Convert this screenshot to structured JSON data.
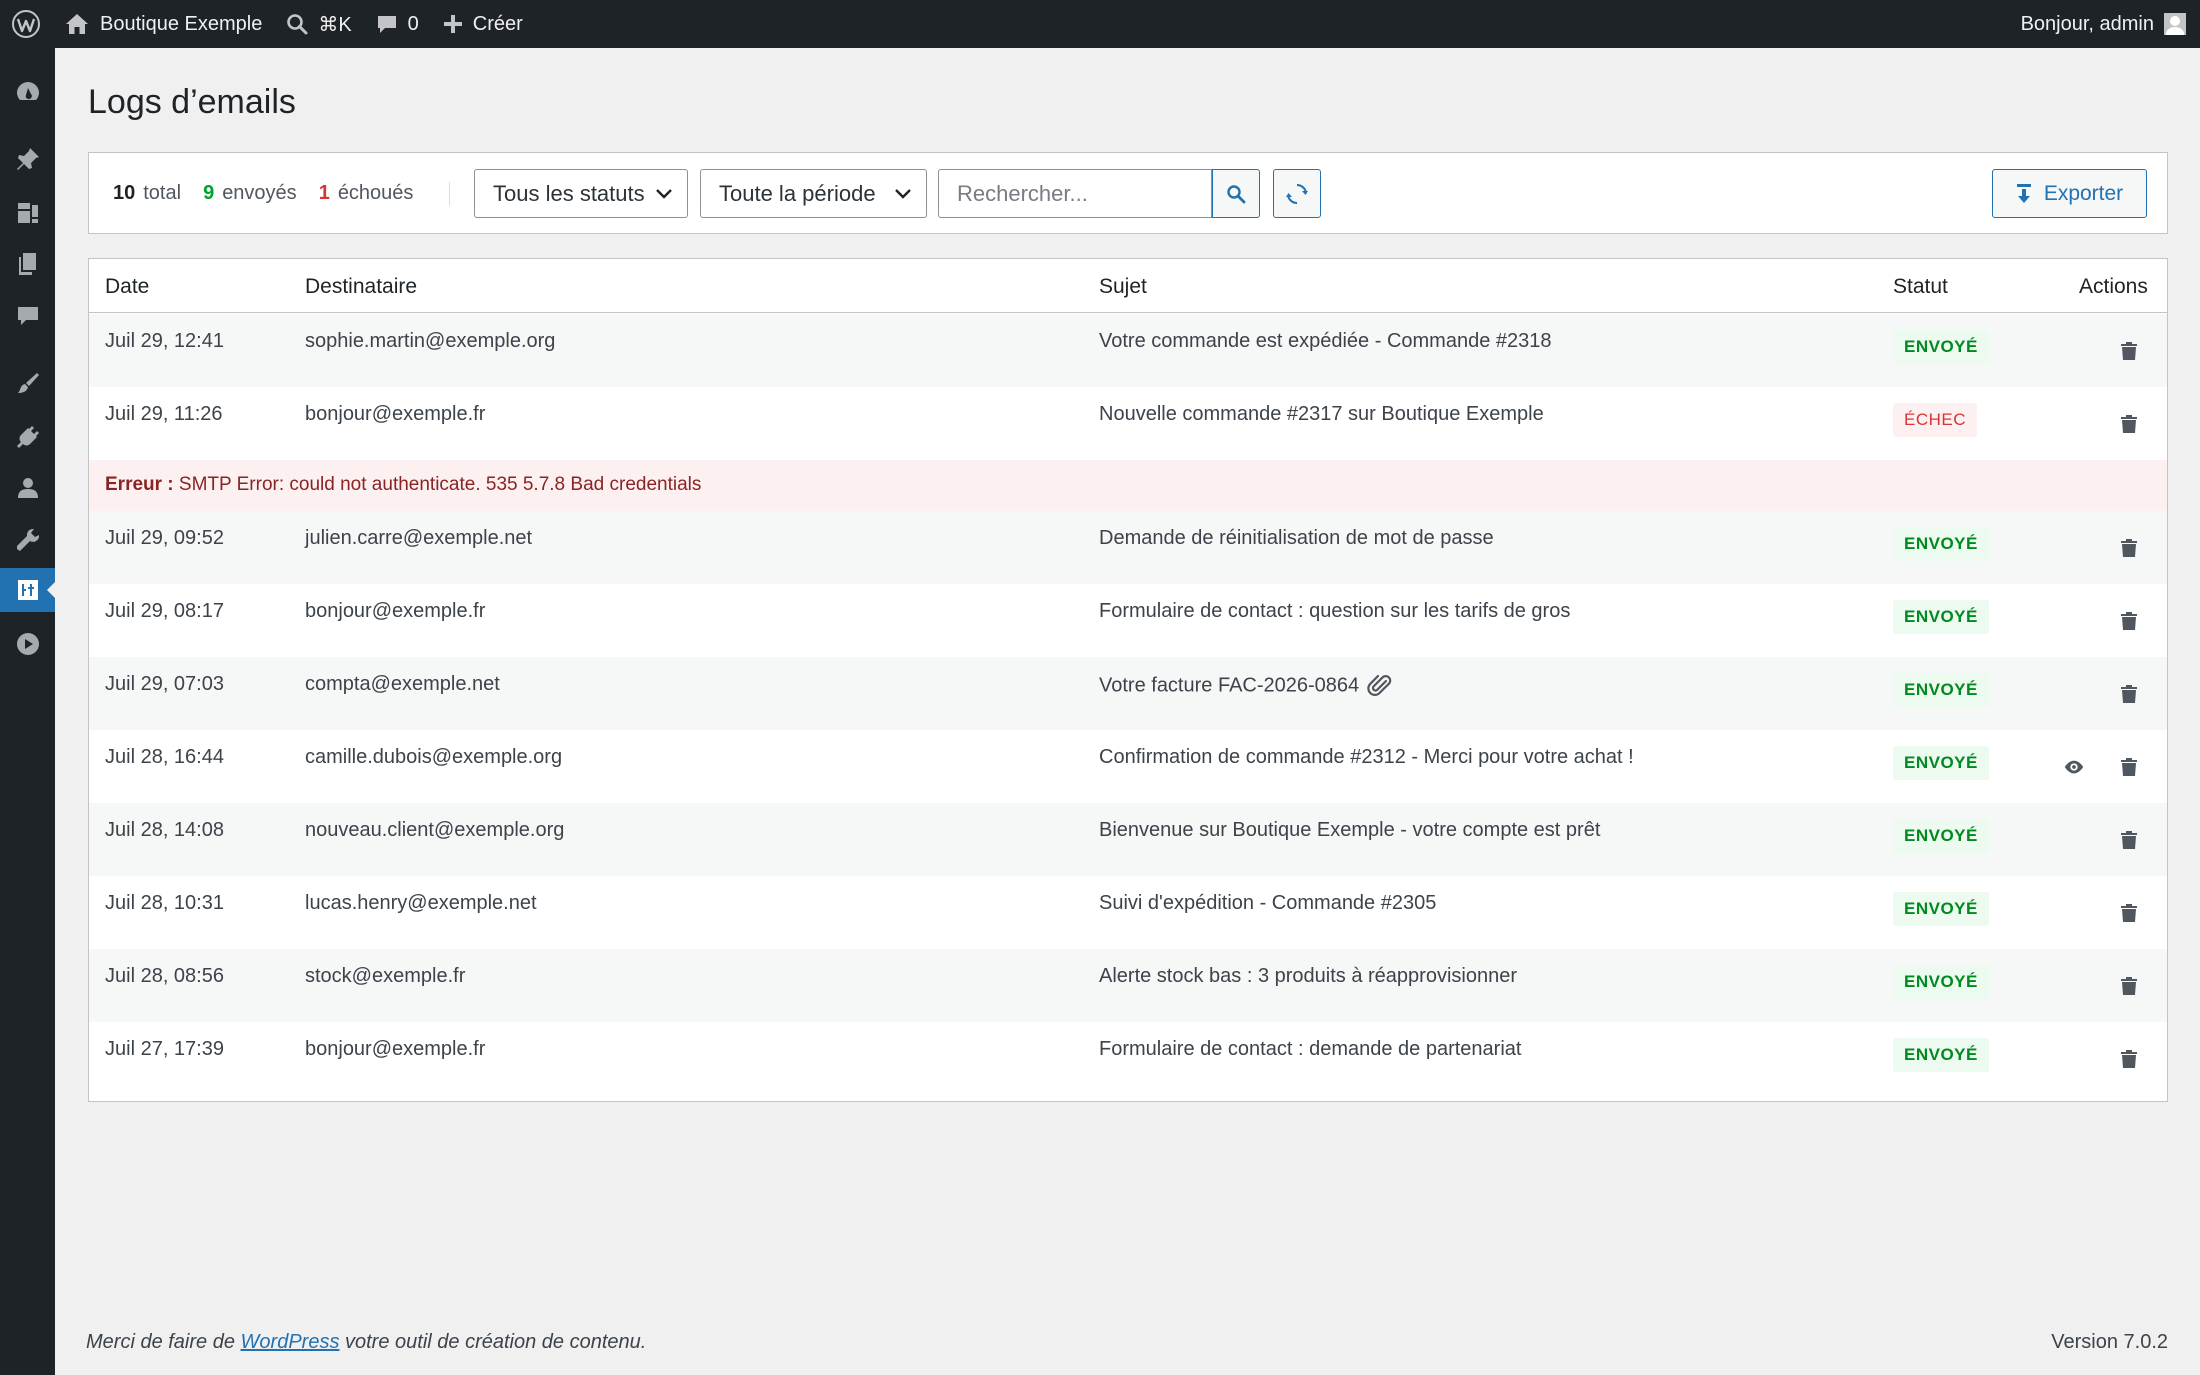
{
  "adminbar": {
    "site_name": "Boutique Exemple",
    "shortcut": "⌘K",
    "comments_count": "0",
    "create_label": "Créer",
    "greeting": "Bonjour, admin"
  },
  "page": {
    "title": "Logs d’emails"
  },
  "stats": {
    "total_num": "10",
    "total_label": "total",
    "sent_num": "9",
    "sent_label": "envoyés",
    "failed_num": "1",
    "failed_label": "échoués"
  },
  "filters": {
    "status_selected": "Tous les statuts",
    "period_selected": "Toute la période",
    "search_placeholder": "Rechercher...",
    "export_label": "Exporter"
  },
  "table": {
    "headers": {
      "date": "Date",
      "recipient": "Destinataire",
      "subject": "Sujet",
      "status": "Statut",
      "actions": "Actions"
    },
    "rows": [
      {
        "date": "Juil 29, 12:41",
        "recipient": "sophie.martin@exemple.org",
        "subject": "Votre commande est expédiée - Commande #2318",
        "status": "ENVOYÉ"
      },
      {
        "date": "Juil 29, 11:26",
        "recipient": "bonjour@exemple.fr",
        "subject": "Nouvelle commande #2317 sur Boutique Exemple",
        "status": "ÉCHEC"
      },
      {
        "date": "Juil 29, 09:52",
        "recipient": "julien.carre@exemple.net",
        "subject": "Demande de réinitialisation de mot de passe",
        "status": "ENVOYÉ"
      },
      {
        "date": "Juil 29, 08:17",
        "recipient": "bonjour@exemple.fr",
        "subject": "Formulaire de contact : question sur les tarifs de gros",
        "status": "ENVOYÉ"
      },
      {
        "date": "Juil 29, 07:03",
        "recipient": "compta@exemple.net",
        "subject": "Votre facture FAC-2026-0864",
        "status": "ENVOYÉ"
      },
      {
        "date": "Juil 28, 16:44",
        "recipient": "camille.dubois@exemple.org",
        "subject": "Confirmation de commande #2312 - Merci pour votre achat !",
        "status": "ENVOYÉ"
      },
      {
        "date": "Juil 28, 14:08",
        "recipient": "nouveau.client@exemple.org",
        "subject": "Bienvenue sur Boutique Exemple - votre compte est prêt",
        "status": "ENVOYÉ"
      },
      {
        "date": "Juil 28, 10:31",
        "recipient": "lucas.henry@exemple.net",
        "subject": "Suivi d'expédition - Commande #2305",
        "status": "ENVOYÉ"
      },
      {
        "date": "Juil 28, 08:56",
        "recipient": "stock@exemple.fr",
        "subject": "Alerte stock bas : 3 produits à réapprovisionner",
        "status": "ENVOYÉ"
      },
      {
        "date": "Juil 27, 17:39",
        "recipient": "bonjour@exemple.fr",
        "subject": "Formulaire de contact : demande de partenariat",
        "status": "ENVOYÉ"
      }
    ],
    "error": {
      "label": "Erreur :",
      "message": "SMTP Error: could not authenticate. 535 5.7.8 Bad credentials"
    }
  },
  "footer": {
    "thanks_before": "Merci de faire de",
    "thanks_link": "WordPress",
    "thanks_after": "votre outil de création de contenu.",
    "version": "Version 7.0.2"
  },
  "colors": {
    "accent": "#2271b1",
    "sent": "#00a32a",
    "failed": "#d63638",
    "adminbar": "#1d2327"
  }
}
